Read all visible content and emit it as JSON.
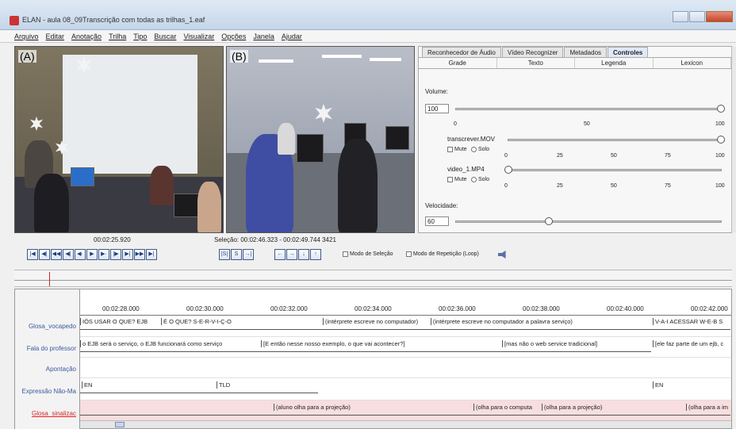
{
  "window": {
    "title": "ELAN - aula 08_09Transcrição com todas as trilhas_1.eaf"
  },
  "menu": [
    "Arquivo",
    "Editar",
    "Anotação",
    "Trilha",
    "Tipo",
    "Buscar",
    "Visualizar",
    "Opções",
    "Janela",
    "Ajudar"
  ],
  "videos": {
    "a_label": "(A)",
    "b_label": "(B)"
  },
  "tabs": [
    "Reconhecedor de Áudio",
    "Vídeo Recognizer",
    "Metadados",
    "Controles"
  ],
  "active_tab": "Controles",
  "subtabs": [
    "Grade",
    "Texto",
    "Legenda",
    "Lexicon"
  ],
  "controls": {
    "volume_label": "Volume:",
    "volume_value": "100",
    "volume_ticks": [
      "0",
      "50",
      "100"
    ],
    "track1": "transcrever.MOV",
    "track2": "video_1.MP4",
    "mute": "Mute",
    "solo": "Solo",
    "track_ticks": [
      "0",
      "25",
      "50",
      "75",
      "100"
    ],
    "speed_label": "Velocidade:",
    "speed_value": "60",
    "volume_level": 1.0,
    "track1_level": 1.0,
    "track2_level": 0.0,
    "speed_level": 0.35
  },
  "media": {
    "current_time": "00:02:25.920",
    "selection": "Seleção: 00:02:46.323 - 00:02:49.744  3421",
    "buttons": [
      "|◀",
      "◀|",
      "◀◀",
      "◀|",
      "◀·",
      "▶",
      "▶·",
      "|▶",
      "▶|",
      "▶▶",
      "▶|"
    ],
    "sel_buttons": [
      "|S|",
      "S",
      "→|"
    ],
    "nav_buttons": [
      "←",
      "→",
      "↓",
      "↑"
    ],
    "selection_mode": "Modo de Seleção",
    "loop_mode": "Modo de Repetição (Loop)"
  },
  "timeline": {
    "ruler": [
      "00:02:28.000",
      "00:02:30.000",
      "00:02:32.000",
      "00:02:34.000",
      "00:02:36.000",
      "00:02:38.000",
      "00:02:40.000",
      "00:02:42.000"
    ],
    "tiers": [
      {
        "name": "Glosa_vocapedo",
        "annotations": [
          "IÓS USAR O QUE? EJB",
          "É O QUE? S-E-R-V-I-Ç-O",
          "(intérprete escreve no computador)",
          "(intérprete escreve no computador a palavra serviço)",
          "V-A-I ACESSAR W-E-B  S"
        ]
      },
      {
        "name": "Fala do professor",
        "annotations": [
          "o EJB será o serviço, o EJB funcionará como serviço",
          "[E então nesse nosso exemplo, o que vai acontecer?]",
          "[mas não o web service tradicional]",
          "[ele faz parte de um ejb, c"
        ]
      },
      {
        "name": "Apontação",
        "annotations": []
      },
      {
        "name": "Expressão Não-Ma",
        "annotations": [
          "EN",
          "TLD",
          "EN"
        ]
      },
      {
        "name": "Glosa_sinalizac",
        "annotations": [
          "(aluno olha para a projeção)",
          "(olha para o computa",
          "(olha para a projeção)",
          "(olha para a im"
        ]
      }
    ]
  }
}
